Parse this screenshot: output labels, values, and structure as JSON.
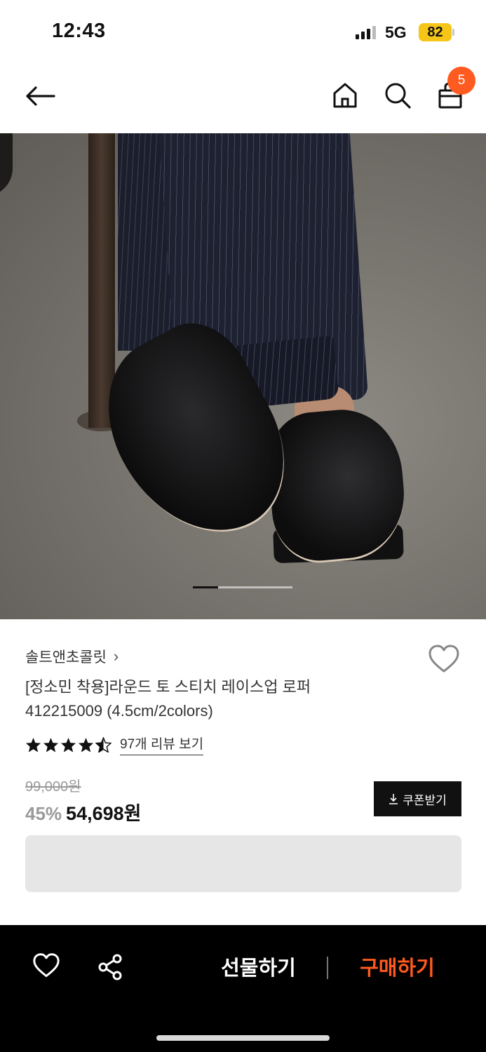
{
  "status_bar": {
    "time": "12:43",
    "network": "5G",
    "battery": "82",
    "battery_color": "#f5c518"
  },
  "nav": {
    "back_icon": "arrow-left-icon",
    "home_icon": "home-icon",
    "search_icon": "search-icon",
    "bag_icon": "shopping-bag-icon",
    "cart_count": "5",
    "badge_color": "#ff5a1f"
  },
  "carousel": {
    "image_alt": "product-photo",
    "current_index": 1,
    "total": 4
  },
  "product": {
    "brand": "솔트앤초콜릿",
    "brand_chevron": "›",
    "title_line1": "[정소민 착용]라운드 토 스티치 레이스업 로퍼",
    "title_line2": "412215009 (4.5cm/2colors)",
    "rating": 4.5,
    "review_link": "97개 리뷰 보기",
    "original_price": "99,000원",
    "discount": "45%",
    "sale_price": "54,698원",
    "coupon_label": "쿠폰받기",
    "coupon_icon": "download-icon"
  },
  "bottom_bar": {
    "like_icon": "heart-outline-icon",
    "share_icon": "share-icon",
    "gift_label": "선물하기",
    "buy_label": "구매하기",
    "buy_color": "#ff5a1f"
  }
}
